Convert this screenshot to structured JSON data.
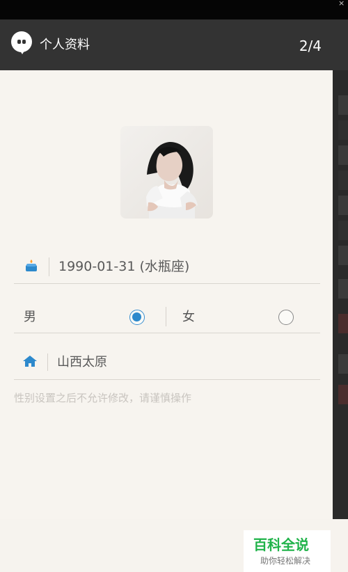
{
  "status_bar": {
    "corner_mark": "×"
  },
  "header": {
    "title": "个人资料",
    "page_indicator": "2/4",
    "icon": "chat-bubble-icon"
  },
  "profile": {
    "avatar": "profile-photo",
    "birthday": "1990-01-31 (水瓶座)",
    "gender_options": {
      "male": "男",
      "female": "女",
      "selected": "男"
    },
    "location": "山西太原",
    "hint": "性别设置之后不允许修改，请谨慎操作"
  },
  "icons": {
    "birthday": "birthday-cake-icon",
    "location": "home-icon"
  },
  "watermark": {
    "title": "百科全说",
    "subtitle": "助你轻松解决"
  },
  "colors": {
    "header_bg": "#333333",
    "page_bg": "#F7F4EF",
    "accent": "#2D89CC",
    "hint_text": "#C8C4BF",
    "watermark_green": "#20B34A"
  }
}
